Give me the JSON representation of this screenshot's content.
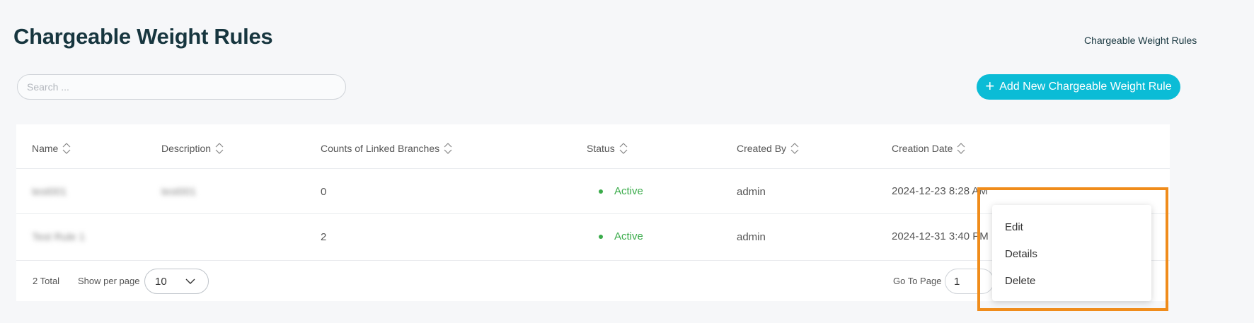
{
  "page": {
    "title": "Chargeable Weight Rules",
    "breadcrumb": "Chargeable Weight Rules"
  },
  "search": {
    "placeholder": "Search ...",
    "value": ""
  },
  "add_button": {
    "label": "Add New Chargeable Weight Rule",
    "icon": "plus-icon"
  },
  "table": {
    "columns": [
      "Name",
      "Description",
      "Counts of Linked Branches",
      "Status",
      "Created By",
      "Creation Date"
    ],
    "rows": [
      {
        "name": "test001",
        "description": "test001",
        "linked_branches": "0",
        "status": "Active",
        "created_by": "admin",
        "creation_date": "2024-12-23 8:28 AM"
      },
      {
        "name": "Test Rule 1",
        "description": "",
        "linked_branches": "2",
        "status": "Active",
        "created_by": "admin",
        "creation_date": "2024-12-31 3:40 PM"
      }
    ]
  },
  "footer": {
    "total": "2 Total",
    "show_per_page_label": "Show per page",
    "per_page_value": "10",
    "goto_label": "Go To Page",
    "goto_value": "1"
  },
  "context_menu": {
    "items": [
      "Edit",
      "Details",
      "Delete"
    ]
  },
  "colors": {
    "accent": "#0bbcd6",
    "title": "#17363f",
    "status_active": "#3aab4a",
    "highlight": "#f08c1b"
  }
}
